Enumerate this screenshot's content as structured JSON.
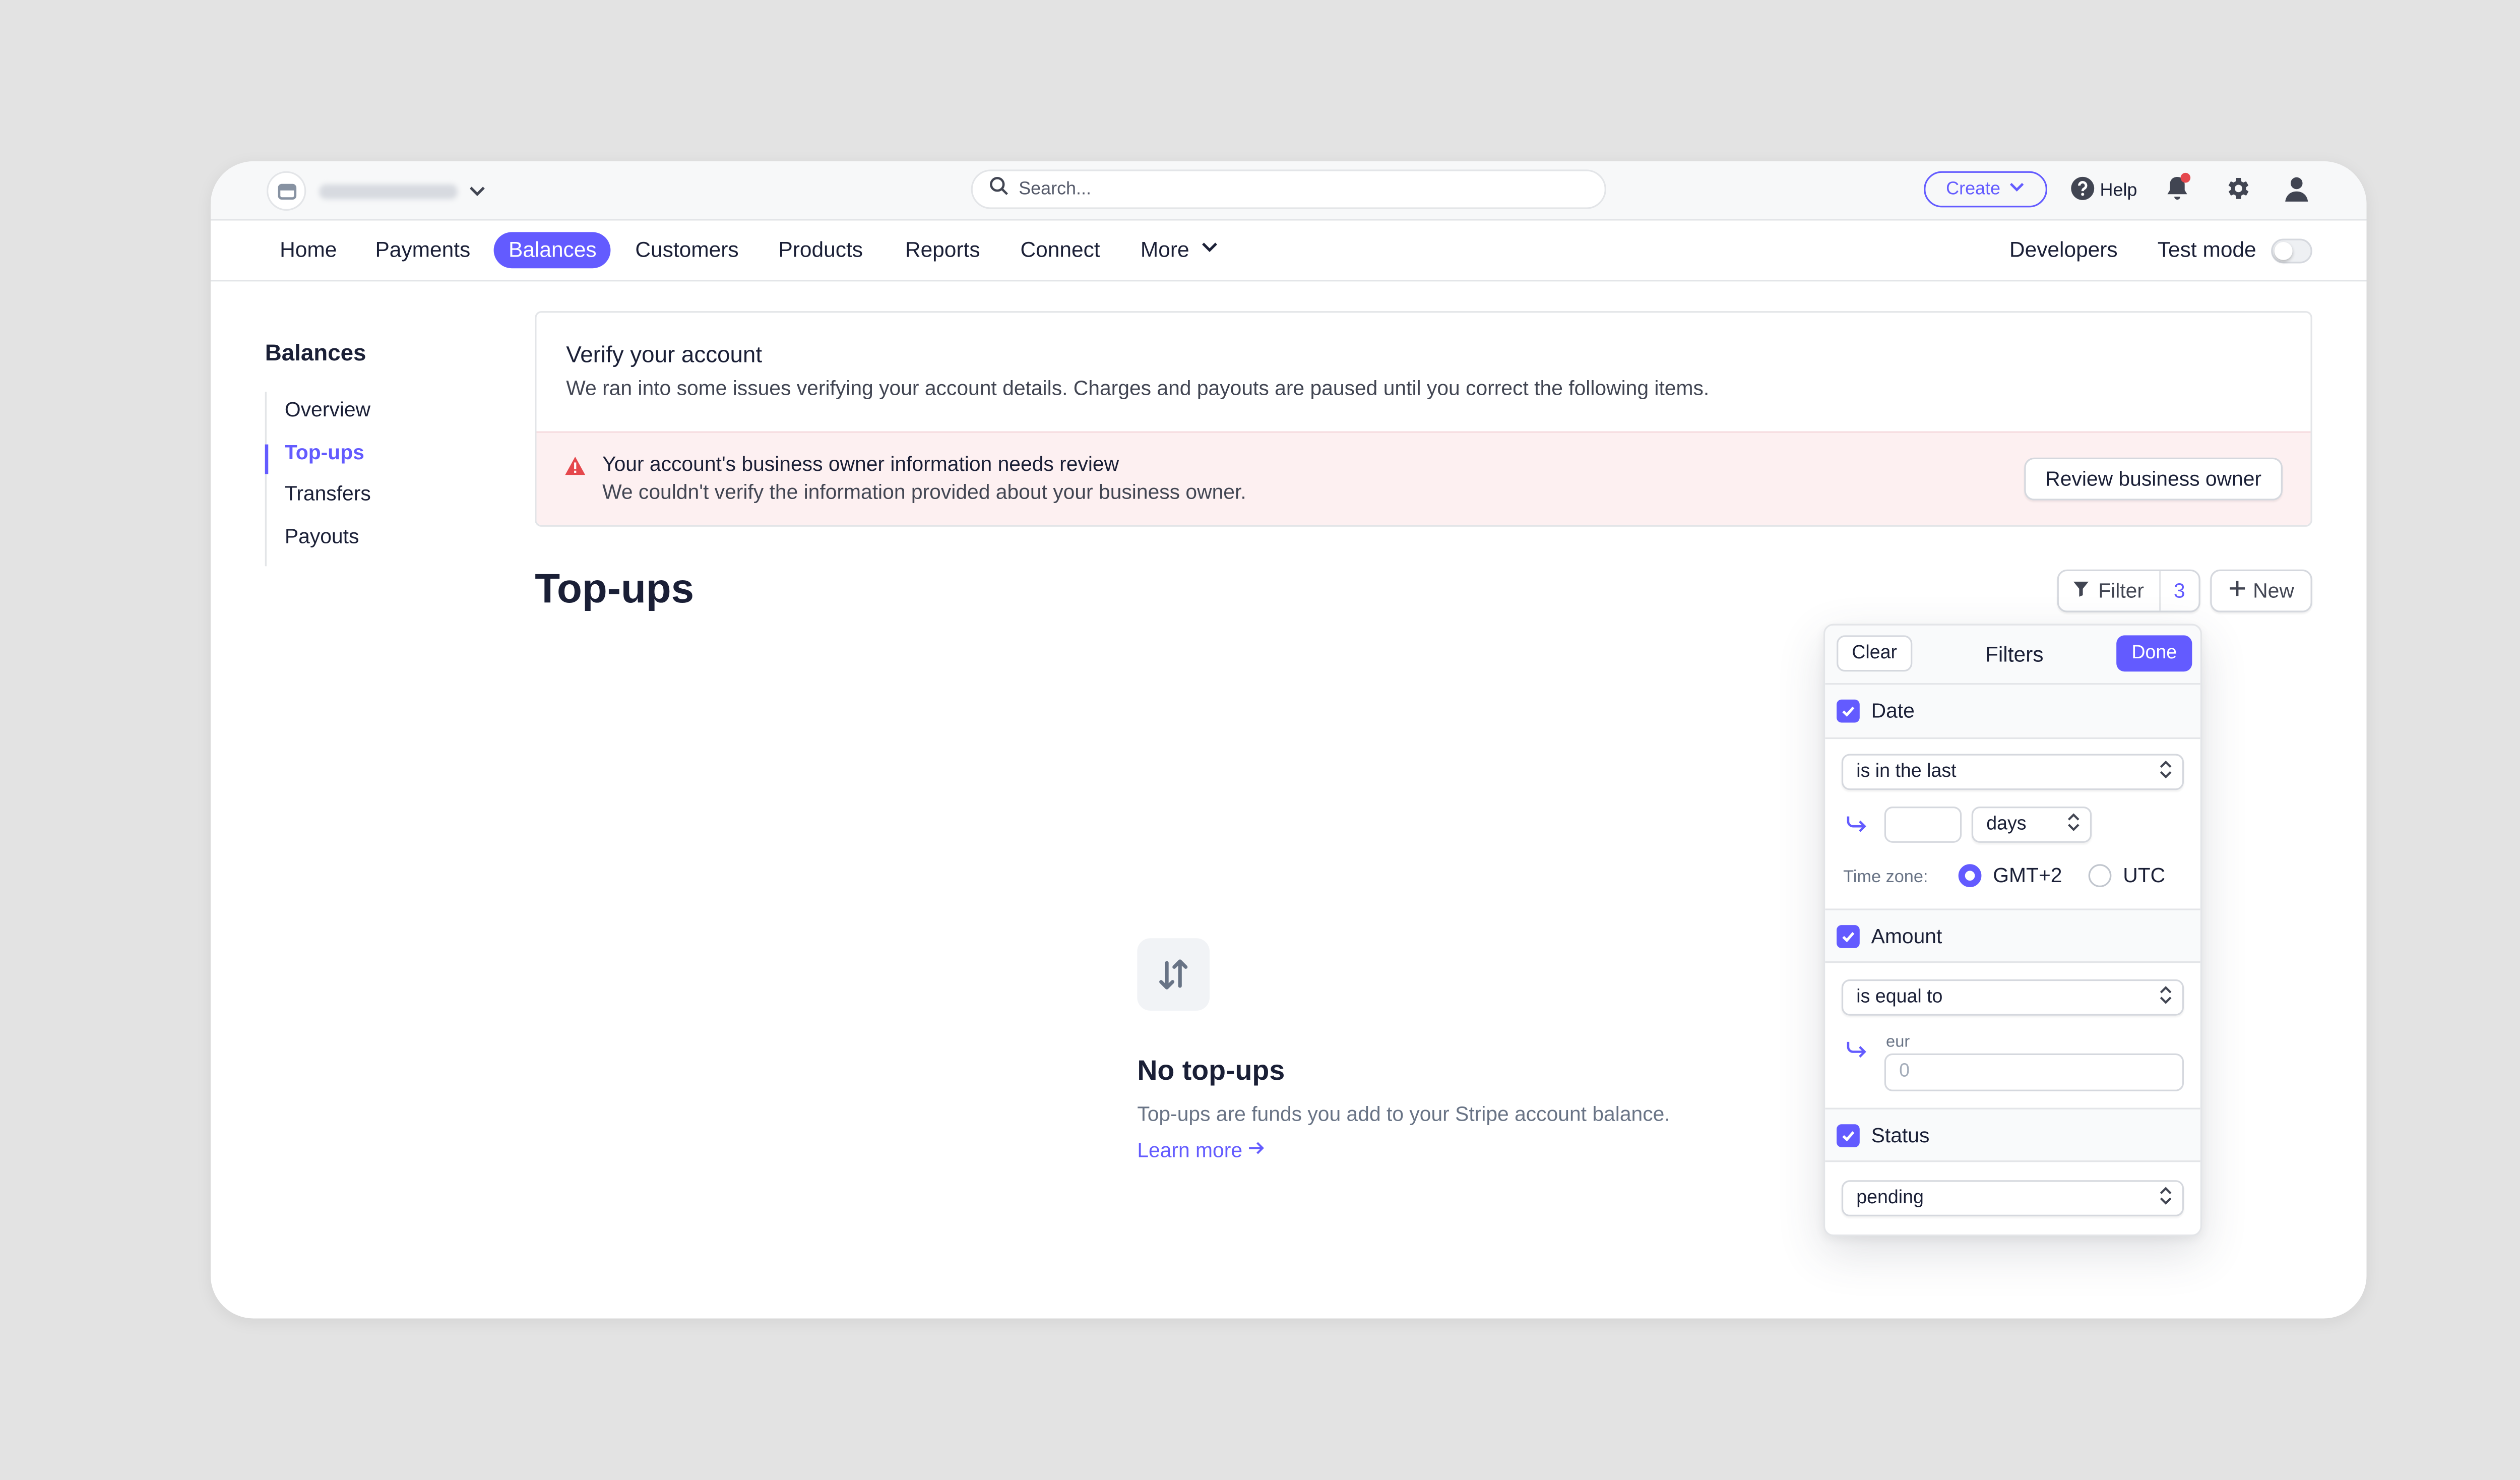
{
  "topbar": {
    "account_name": "",
    "search_placeholder": "Search...",
    "create_label": "Create",
    "help_label": "Help",
    "notification_dot_color": "#e5484d"
  },
  "nav": {
    "items": [
      {
        "label": "Home"
      },
      {
        "label": "Payments"
      },
      {
        "label": "Balances",
        "active": true
      },
      {
        "label": "Customers"
      },
      {
        "label": "Products"
      },
      {
        "label": "Reports"
      },
      {
        "label": "Connect"
      },
      {
        "label": "More"
      }
    ],
    "developers_label": "Developers",
    "test_mode_label": "Test mode",
    "test_mode_on": false
  },
  "sidebar": {
    "title": "Balances",
    "items": [
      {
        "label": "Overview"
      },
      {
        "label": "Top-ups",
        "active": true
      },
      {
        "label": "Transfers"
      },
      {
        "label": "Payouts"
      }
    ]
  },
  "verify": {
    "title": "Verify your account",
    "description": "We ran into some issues verifying your account details. Charges and payouts are paused until you correct the following items.",
    "alert_title": "Your account's business owner information needs review",
    "alert_description": "We couldn't verify the information provided about your business owner.",
    "review_button": "Review business owner"
  },
  "page": {
    "title": "Top-ups",
    "filter_label": "Filter",
    "filter_count": "3",
    "new_label": "New"
  },
  "empty_state": {
    "title": "No top-ups",
    "description": "Top-ups are funds you add to your Stripe account balance.",
    "link": "Learn more"
  },
  "filters": {
    "clear_label": "Clear",
    "title": "Filters",
    "done_label": "Done",
    "date": {
      "label": "Date",
      "checked": true,
      "operator": "is in the last",
      "value": "",
      "unit": "days",
      "timezone_label": "Time zone:",
      "timezone_options": [
        "GMT+2",
        "UTC"
      ],
      "timezone_selected": "GMT+2"
    },
    "amount": {
      "label": "Amount",
      "checked": true,
      "operator": "is equal to",
      "currency": "eur",
      "placeholder": "0"
    },
    "status": {
      "label": "Status",
      "checked": true,
      "value": "pending"
    }
  },
  "colors": {
    "accent": "#635bff",
    "alert_bg": "#fdf0f1",
    "alert_icon": "#e5484d",
    "page_bg": "#e3e3e3"
  }
}
